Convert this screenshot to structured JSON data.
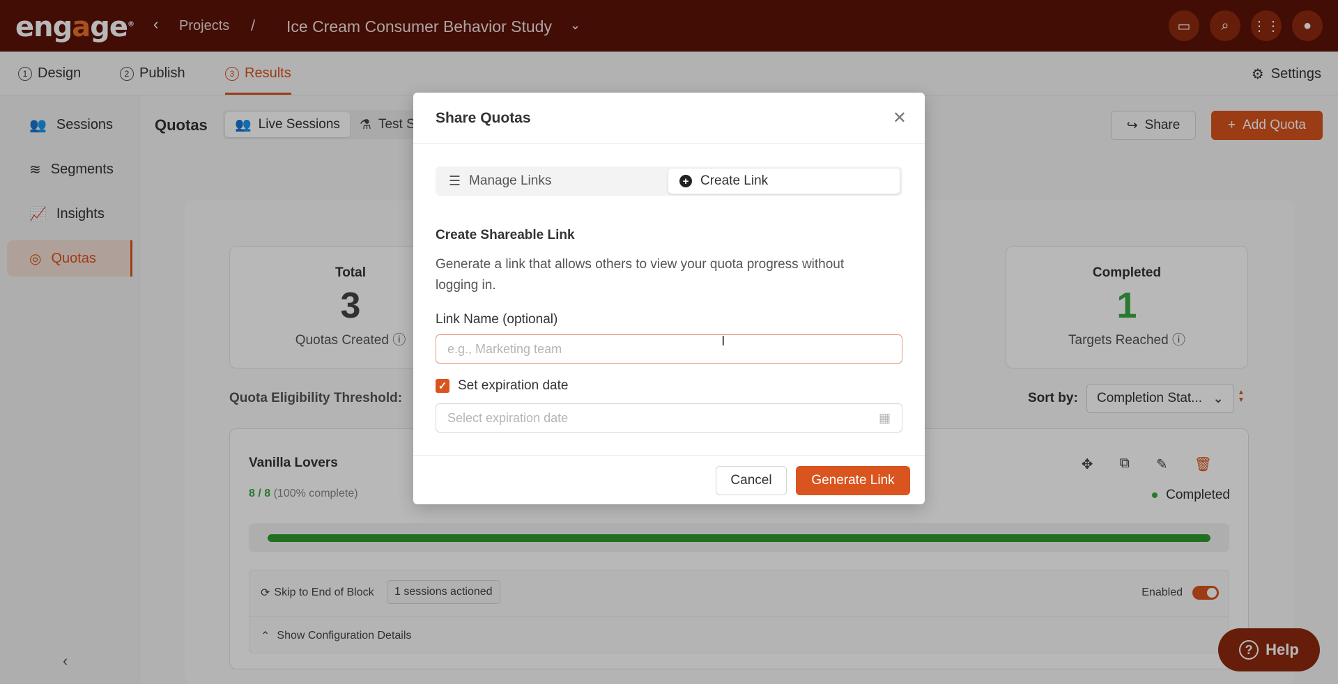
{
  "brand": {
    "logo_text": "engage",
    "accent": "#d9541e",
    "topbar_bg": "#5a1208"
  },
  "breadcrumb": {
    "back_icon": "chevron-left-icon",
    "projects": "Projects",
    "separator": "/",
    "project": "Ice Cream Consumer Behavior Study"
  },
  "top_icons": [
    "presentation-icon",
    "search-icon",
    "apps-grid-icon",
    "user-icon"
  ],
  "nav_tabs": [
    {
      "num": "1",
      "label": "Design"
    },
    {
      "num": "2",
      "label": "Publish"
    },
    {
      "num": "3",
      "label": "Results",
      "active": true
    }
  ],
  "settings_label": "Settings",
  "sidebar": {
    "items": [
      {
        "label": "Sessions",
        "icon": "users-icon"
      },
      {
        "label": "Segments",
        "icon": "layers-icon"
      },
      {
        "label": "Insights",
        "icon": "chart-icon"
      },
      {
        "label": "Quotas",
        "icon": "target-icon",
        "active": true
      }
    ],
    "collapse_icon": "chevron-left-icon"
  },
  "main": {
    "title": "Quotas",
    "seg_tabs": [
      {
        "label": "Live Sessions"
      },
      {
        "label": "Test S"
      }
    ],
    "share_label": "Share",
    "add_quota_label": "Add Quota",
    "stats": [
      {
        "label": "Total",
        "value": "3",
        "sub": "Quotas Created"
      },
      {
        "label": "Completed",
        "value": "1",
        "sub": "Targets Reached"
      }
    ],
    "threshold_label": "Quota Eligibility Threshold:",
    "sort_label": "Sort by:",
    "sort_value": "Completion Stat...",
    "quota": {
      "name": "Vanilla Lovers",
      "progress": "8 / 8",
      "progress_pct_text": "(100% complete)",
      "progress_fraction": 1.0,
      "status": "Completed",
      "rule_action": "Skip to End of Block",
      "sessions_badge": "1 sessions actioned",
      "enabled_label": "Enabled",
      "config_label": "Show Configuration Details"
    },
    "help_label": "Help"
  },
  "modal": {
    "title": "Share Quotas",
    "tabs": [
      {
        "label": "Manage Links"
      },
      {
        "label": "Create Link"
      }
    ],
    "heading": "Create Shareable Link",
    "description": "Generate a link that allows others to view your quota progress without logging in.",
    "link_name_label": "Link Name (optional)",
    "link_name_placeholder": "e.g., Marketing team",
    "expiration_checkbox_label": "Set expiration date",
    "expiration_checked": true,
    "expiration_placeholder": "Select expiration date",
    "cancel_label": "Cancel",
    "generate_label": "Generate Link"
  }
}
